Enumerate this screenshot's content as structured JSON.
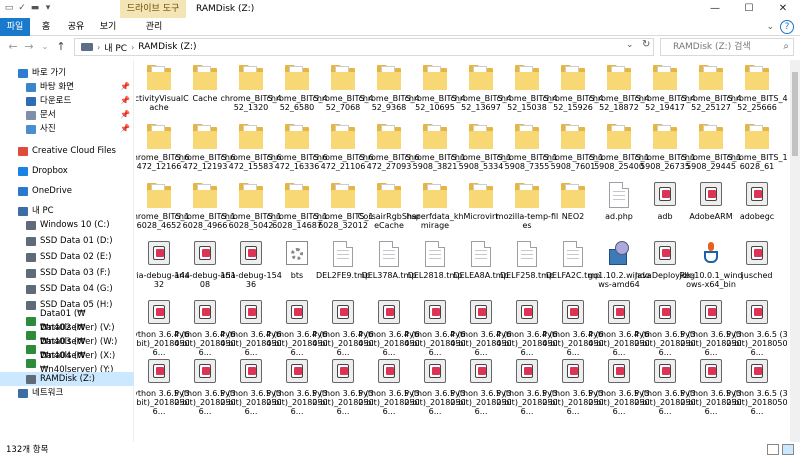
{
  "window": {
    "context_tab": "드라이브 도구",
    "title": "RAMDisk (Z:)",
    "controls": {
      "minimize": "—",
      "maximize": "☐",
      "close": "✕"
    }
  },
  "ribbon": {
    "tabs": [
      {
        "label": "파일"
      },
      {
        "label": "홈"
      },
      {
        "label": "공유"
      },
      {
        "label": "보기"
      },
      {
        "label": "관리"
      }
    ],
    "help": "?"
  },
  "address": {
    "crumbs": [
      "내 PC",
      "RAMDisk (Z:)"
    ],
    "search_placeholder": "RAMDisk (Z:) 검색"
  },
  "sidebar": {
    "items": [
      {
        "label": "바로 가기",
        "icon": "star-icon",
        "color": "#2d7dd2",
        "pinned": false
      },
      {
        "label": "바탕 화면",
        "icon": "desktop-icon",
        "color": "#3b86c8",
        "pinned": true
      },
      {
        "label": "다운로드",
        "icon": "download-icon",
        "color": "#2d6db5",
        "pinned": true
      },
      {
        "label": "문서",
        "icon": "document-icon",
        "color": "#7f8fa8",
        "pinned": true
      },
      {
        "label": "사진",
        "icon": "pictures-icon",
        "color": "#4a8ecf",
        "pinned": true
      },
      {
        "label": "Creative Cloud Files",
        "icon": "creative-cloud-icon",
        "color": "#e04a3a",
        "pinned": false
      },
      {
        "label": "Dropbox",
        "icon": "dropbox-icon",
        "color": "#1a82e2",
        "pinned": false
      },
      {
        "label": "OneDrive",
        "icon": "onedrive-icon",
        "color": "#2b78d0",
        "pinned": false
      },
      {
        "label": "내 PC",
        "icon": "pc-icon",
        "color": "#3a6ea5",
        "pinned": false
      },
      {
        "label": "Windows 10 (C:)",
        "icon": "drive-icon",
        "color": "#5f6b78",
        "pinned": false
      },
      {
        "label": "SSD Data 01 (D:)",
        "icon": "drive-icon",
        "color": "#5f6b78",
        "pinned": false
      },
      {
        "label": "SSD Data 02 (E:)",
        "icon": "drive-icon",
        "color": "#5f6b78",
        "pinned": false
      },
      {
        "label": "SSD Data 03 (F:)",
        "icon": "drive-icon",
        "color": "#5f6b78",
        "pinned": false
      },
      {
        "label": "SSD Data 04 (G:)",
        "icon": "drive-icon",
        "color": "#5f6b78",
        "pinned": false
      },
      {
        "label": "SSD Data 05 (H:)",
        "icon": "drive-icon",
        "color": "#5f6b78",
        "pinned": false
      },
      {
        "label": "Data01 (₩₩n40lserver) (V:)",
        "icon": "network-drive-icon",
        "color": "#2e8b3a",
        "pinned": false
      },
      {
        "label": "Data02 (₩₩n40lserver) (W:)",
        "icon": "network-drive-icon",
        "color": "#2e8b3a",
        "pinned": false
      },
      {
        "label": "Data03 (₩₩n40lserver) (X:)",
        "icon": "network-drive-icon",
        "color": "#2e8b3a",
        "pinned": false
      },
      {
        "label": "Data04 (₩₩n40lserver) (Y:)",
        "icon": "network-drive-icon",
        "color": "#2e8b3a",
        "pinned": false
      },
      {
        "label": "RAMDisk (Z:)",
        "icon": "drive-icon",
        "color": "#5f6b78",
        "pinned": false,
        "selected": true
      },
      {
        "label": "네트워크",
        "icon": "network-icon",
        "color": "#3a6ea5",
        "pinned": false
      }
    ]
  },
  "files": [
    {
      "name": "ActivityVisualCache",
      "type": "folder"
    },
    {
      "name": "Cache",
      "type": "folder"
    },
    {
      "name": "chrome_BITS_452_1320",
      "type": "folder"
    },
    {
      "name": "chrome_BITS_452_6580",
      "type": "folder"
    },
    {
      "name": "chrome_BITS_452_7068",
      "type": "folder"
    },
    {
      "name": "chrome_BITS_452_9368",
      "type": "folder"
    },
    {
      "name": "chrome_BITS_452_10695",
      "type": "folder"
    },
    {
      "name": "chrome_BITS_452_13697",
      "type": "folder"
    },
    {
      "name": "chrome_BITS_452_15038",
      "type": "folder"
    },
    {
      "name": "chrome_BITS_452_15926",
      "type": "folder"
    },
    {
      "name": "chrome_BITS_452_18872",
      "type": "folder"
    },
    {
      "name": "chrome_BITS_452_19417",
      "type": "folder"
    },
    {
      "name": "chrome_BITS_452_25127",
      "type": "folder"
    },
    {
      "name": "chrome_BITS_452_25666",
      "type": "folder"
    },
    {
      "name": "chrome_BITS_6472_12166",
      "type": "folder"
    },
    {
      "name": "chrome_BITS_6472_12193",
      "type": "folder"
    },
    {
      "name": "chrome_BITS_6472_15583",
      "type": "folder"
    },
    {
      "name": "chrome_BITS_6472_16336",
      "type": "folder"
    },
    {
      "name": "chrome_BITS_6472_21106",
      "type": "folder"
    },
    {
      "name": "chrome_BITS_6472_27093",
      "type": "folder"
    },
    {
      "name": "chrome_BITS_15908_3821",
      "type": "folder"
    },
    {
      "name": "chrome_BITS_15908_5334",
      "type": "folder"
    },
    {
      "name": "chrome_BITS_15908_7355",
      "type": "folder"
    },
    {
      "name": "chrome_BITS_15908_7601",
      "type": "folder"
    },
    {
      "name": "chrome_BITS_15908_25400",
      "type": "folder"
    },
    {
      "name": "chrome_BITS_15908_26735",
      "type": "folder"
    },
    {
      "name": "chrome_BITS_15908_29445",
      "type": "folder"
    },
    {
      "name": "chrome_BITS_16028_61",
      "type": "folder"
    },
    {
      "name": "chrome_BITS_16028_4652",
      "type": "folder"
    },
    {
      "name": "chrome_BITS_16028_4966",
      "type": "folder"
    },
    {
      "name": "chrome_BITS_16028_5042",
      "type": "folder"
    },
    {
      "name": "chrome_BITS_16028_14687",
      "type": "folder"
    },
    {
      "name": "chrome_BITS_16028_32012",
      "type": "folder"
    },
    {
      "name": "CorsairRgbShareCache",
      "type": "folder"
    },
    {
      "name": "hsperfdata_khmirage",
      "type": "folder"
    },
    {
      "name": "Microvirt",
      "type": "folder"
    },
    {
      "name": "mozilla-temp-files",
      "type": "folder"
    },
    {
      "name": "NEO2",
      "type": "folder"
    },
    {
      "name": "ad.php",
      "type": "doc"
    },
    {
      "name": "adb",
      "type": "pkg"
    },
    {
      "name": "AdobeARM",
      "type": "pkg"
    },
    {
      "name": "adobegc",
      "type": "pkg"
    },
    {
      "name": "aria-debug-14432",
      "type": "pkg"
    },
    {
      "name": "aria-debug-15108",
      "type": "pkg"
    },
    {
      "name": "aria-debug-15436",
      "type": "pkg"
    },
    {
      "name": "bts",
      "type": "gear"
    },
    {
      "name": "DEL2FE9.tmp",
      "type": "doc"
    },
    {
      "name": "DEL378A.tmp",
      "type": "doc"
    },
    {
      "name": "DEL2818.tmp",
      "type": "doc"
    },
    {
      "name": "DELEA8A.tmp",
      "type": "doc"
    },
    {
      "name": "DELF258.tmp",
      "type": "doc"
    },
    {
      "name": "DELFA2C.tmp",
      "type": "doc"
    },
    {
      "name": "go1.10.2.windows-amd64",
      "type": "inst"
    },
    {
      "name": "JavaDeployReg",
      "type": "pkg"
    },
    {
      "name": "jdk-10.0.1_windows-x64_bin",
      "type": "java"
    },
    {
      "name": "jusched",
      "type": "pkg"
    },
    {
      "name": "Python 3.6.4 (64-bit)_20180506...",
      "type": "pkg"
    },
    {
      "name": "Python 3.6.4 (64-bit)_20180506...",
      "type": "pkg"
    },
    {
      "name": "Python 3.6.4 (64-bit)_20180506...",
      "type": "pkg"
    },
    {
      "name": "Python 3.6.4 (64-bit)_20180506...",
      "type": "pkg"
    },
    {
      "name": "Python 3.6.4 (64-bit)_20180506...",
      "type": "pkg"
    },
    {
      "name": "Python 3.6.4 (64-bit)_20180506...",
      "type": "pkg"
    },
    {
      "name": "Python 3.6.4 (64-bit)_20180506...",
      "type": "pkg"
    },
    {
      "name": "Python 3.6.4 (64-bit)_20180506...",
      "type": "pkg"
    },
    {
      "name": "Python 3.6.4 (64-bit)_20180506...",
      "type": "pkg"
    },
    {
      "name": "Python 3.6.4 (64-bit)_20180506...",
      "type": "pkg"
    },
    {
      "name": "Python 3.6.4 (64-bit)_20180506...",
      "type": "pkg"
    },
    {
      "name": "Python 3.6.5 (32-bit)_20180506...",
      "type": "pkg"
    },
    {
      "name": "Python 3.6.5 (32-bit)_20180506...",
      "type": "pkg"
    },
    {
      "name": "Python 3.6.5 (32-bit)_20180506...",
      "type": "pkg"
    },
    {
      "name": "Python 3.6.5 (32-bit)_20180506...",
      "type": "pkg"
    },
    {
      "name": "Python 3.6.5 (32-bit)_20180506...",
      "type": "pkg"
    },
    {
      "name": "Python 3.6.5 (32-bit)_20180506...",
      "type": "pkg"
    },
    {
      "name": "Python 3.6.5 (32-bit)_20180506...",
      "type": "pkg"
    },
    {
      "name": "Python 3.6.5 (32-bit)_20180506...",
      "type": "pkg"
    },
    {
      "name": "Python 3.6.5 (32-bit)_20180506...",
      "type": "pkg"
    },
    {
      "name": "Python 3.6.5 (32-bit)_20180506...",
      "type": "pkg"
    },
    {
      "name": "Python 3.6.5 (32-bit)_20180506...",
      "type": "pkg"
    },
    {
      "name": "Python 3.6.5 (32-bit)_20180506...",
      "type": "pkg"
    },
    {
      "name": "Python 3.6.5 (32-bit)_20180506...",
      "type": "pkg"
    },
    {
      "name": "Python 3.6.5 (32-bit)_20180506...",
      "type": "pkg"
    },
    {
      "name": "Python 3.6.5 (32-bit)_20180506...",
      "type": "pkg"
    },
    {
      "name": "Python 3.6.5 (32-bit)_20180506...",
      "type": "pkg"
    },
    {
      "name": "Python 3.6.5 (32-bit)_20180506...",
      "type": "pkg"
    }
  ],
  "status": {
    "count": "132개 항목"
  }
}
